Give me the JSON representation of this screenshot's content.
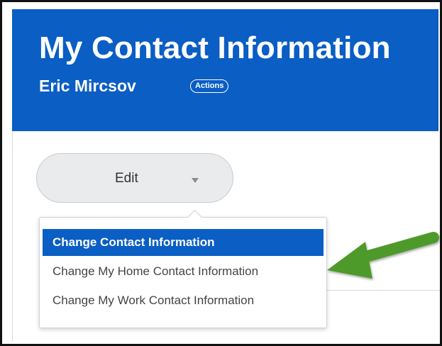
{
  "header": {
    "title": "My Contact Information",
    "worker_name": "Eric Mircsov",
    "actions_label": "Actions"
  },
  "edit_button": {
    "label": "Edit",
    "icon": "chevron-down-icon"
  },
  "dropdown": {
    "items": [
      {
        "label": "Change Contact Information",
        "selected": true
      },
      {
        "label": "Change My Home Contact Information",
        "selected": false
      },
      {
        "label": "Change My Work Contact Information",
        "selected": false
      }
    ]
  },
  "annotation": {
    "icon": "pointer-arrow-icon",
    "color": "#4e9a2b"
  },
  "colors": {
    "header_bg": "#0a5ec4",
    "selected_item_bg": "#0a5ec4",
    "button_bg": "#e9ebec"
  }
}
